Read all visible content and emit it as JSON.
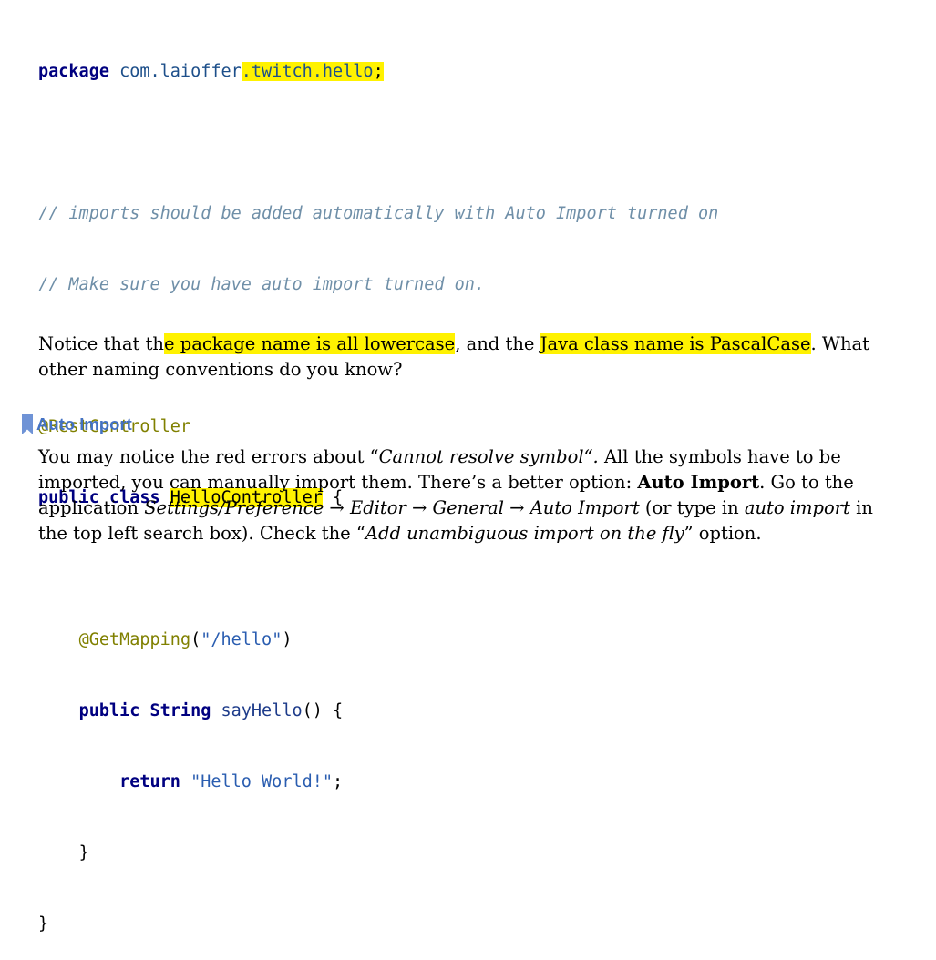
{
  "code": {
    "package_keyword": "package",
    "package_prefix": "com.laioffer",
    "package_highlight": ".twitch.hello",
    "package_semicolon": ";",
    "comment1": "// imports should be added automatically with Auto Import turned on",
    "comment2": "// Make sure you have auto import turned on.",
    "annotation_class": "@RestController",
    "class_modifiers": "public class ",
    "class_name": "HelloController",
    "class_open": " {",
    "annotation_method": "@GetMapping",
    "mapping_open": "(",
    "mapping_value": "\"/hello\"",
    "mapping_close": ")",
    "method_modifiers": "public ",
    "method_type": "String ",
    "method_name": "sayHello",
    "method_sig_end": "() {",
    "return_keyword": "return ",
    "return_value": "\"Hello World!\"",
    "return_end": ";",
    "method_close": "}",
    "class_close": "}"
  },
  "paragraph1": {
    "part1": "Notice that th",
    "part2": "e package name is all lowercase",
    "part3": ", and the ",
    "part4": "Java class name is PascalCase",
    "part5": ". What other naming conventions do you know?"
  },
  "section": {
    "heading": "Auto Import",
    "icon": "bookmark-icon"
  },
  "paragraph2": {
    "t1": "You may notice the red errors about “",
    "t2": "Cannot resolve symbol“.",
    "t3": " All the symbols have to be imported, you can manually import them. There’s a better option: ",
    "t4": "Auto Import",
    "t5": ". Go to the application ",
    "t6": "Settings/Preference → Editor → General → Auto Import",
    "t7": " (or type in ",
    "t8": "auto import",
    "t9": " in the top left search box). Check the “",
    "t10": "Add unambiguous import on the fly",
    "t11": "” option."
  },
  "colors": {
    "highlight": "#fff200",
    "heading": "#4472c4",
    "comment": "#6f8fa8",
    "annotation": "#808000",
    "keyword": "#000080"
  }
}
